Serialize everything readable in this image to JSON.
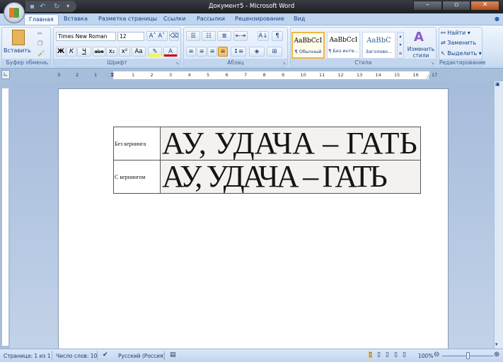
{
  "window": {
    "title": "Документ5 - Microsoft Word"
  },
  "tabs": [
    {
      "label": "Главная",
      "active": true
    },
    {
      "label": "Вставка"
    },
    {
      "label": "Разметка страницы"
    },
    {
      "label": "Ссылки"
    },
    {
      "label": "Рассылки"
    },
    {
      "label": "Рецензирование"
    },
    {
      "label": "Вид"
    }
  ],
  "ribbon": {
    "clipboard": {
      "label": "Буфер обмена",
      "paste": "Вставить"
    },
    "font": {
      "label": "Шрифт",
      "font_name": "Times New Roman",
      "font_size": "12",
      "bold": "Ж",
      "italic": "К",
      "underline": "Ч",
      "strike": "abe",
      "sub": "x₂",
      "sup": "x²",
      "case": "Aa"
    },
    "paragraph": {
      "label": "Абзац"
    },
    "styles": {
      "label": "Стили",
      "items": [
        {
          "preview": "AaBbCcI",
          "name": "¶ Обычный",
          "selected": true
        },
        {
          "preview": "AaBbCcI",
          "name": "¶ Без инте..."
        },
        {
          "preview": "AaBbC",
          "name": "Заголово..."
        }
      ],
      "change": "Изменить стили"
    },
    "editing": {
      "label": "Редактирование",
      "find": "Найти",
      "replace": "Заменить",
      "select": "Выделить"
    }
  },
  "ruler": {
    "left_numbers": [
      "3",
      "2",
      "1"
    ],
    "right_numbers": [
      "1",
      "2",
      "3",
      "4",
      "5",
      "6",
      "7",
      "8",
      "9",
      "10",
      "11",
      "12",
      "13",
      "14",
      "15",
      "16",
      "17"
    ]
  },
  "document": {
    "table": [
      {
        "label": "Без кернинга",
        "text": "АУ, УДАЧА – ГАТЬ",
        "kerning": false
      },
      {
        "label": "С кернингом",
        "text": "АУ, УДАЧА – ГАТЬ",
        "kerning": true
      }
    ]
  },
  "status": {
    "page": "Страница: 1 из 1",
    "words": "Число слов: 10",
    "language": "Русский (Россия)",
    "zoom": "100%",
    "zoom_value": 100
  }
}
